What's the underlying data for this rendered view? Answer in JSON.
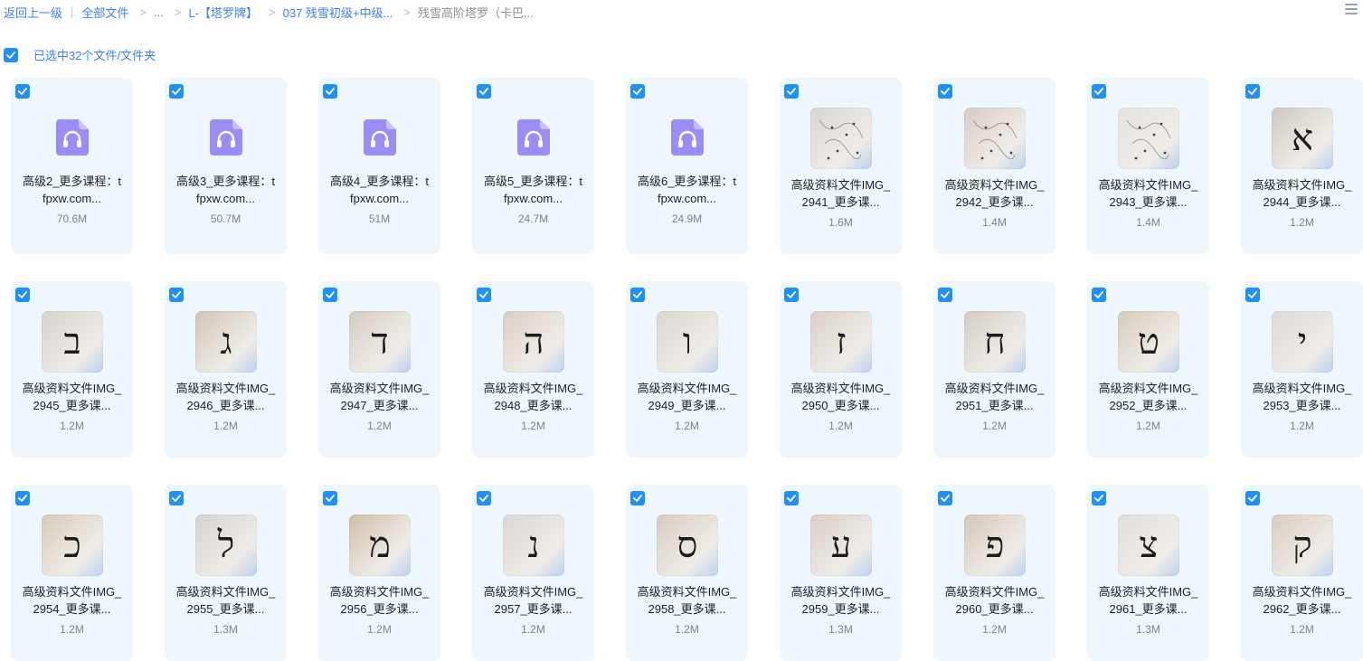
{
  "breadcrumb": {
    "back": "返回上一级",
    "root": "全部文件",
    "ellipsis": "...",
    "crumb1": "L-【塔罗牌】",
    "crumb2": "037 残雪初级+中级...",
    "current": "残雪高阶塔罗（卡巴..."
  },
  "selection": {
    "label": "已选中32个文件/文件夹"
  },
  "files": [
    {
      "type": "audio",
      "name1": "高级2_更多课程：t",
      "name2": "fpxw.com...",
      "size": "70.6M"
    },
    {
      "type": "audio",
      "name1": "高级3_更多课程：t",
      "name2": "fpxw.com...",
      "size": "50.7M"
    },
    {
      "type": "audio",
      "name1": "高级4_更多课程：t",
      "name2": "fpxw.com...",
      "size": "51M"
    },
    {
      "type": "audio",
      "name1": "高级5_更多课程：t",
      "name2": "fpxw.com...",
      "size": "24.7M"
    },
    {
      "type": "audio",
      "name1": "高级6_更多课程：t",
      "name2": "fpxw.com...",
      "size": "24.9M"
    },
    {
      "type": "image",
      "glyph": "",
      "bg": "#d9d6d2",
      "name1": "高级资料文件IMG_",
      "name2": "2941_更多课...",
      "size": "1.6M"
    },
    {
      "type": "image",
      "glyph": "",
      "bg": "#d8ccc6",
      "name1": "高级资料文件IMG_",
      "name2": "2942_更多课...",
      "size": "1.4M"
    },
    {
      "type": "image",
      "glyph": "",
      "bg": "#e6e2df",
      "name1": "高级资料文件IMG_",
      "name2": "2943_更多课...",
      "size": "1.4M"
    },
    {
      "type": "image",
      "glyph": "א",
      "bg": "#cfc9bf",
      "name1": "高级资料文件IMG_",
      "name2": "2944_更多课...",
      "size": "1.2M"
    },
    {
      "type": "image",
      "glyph": "ב",
      "bg": "#d6d3cf",
      "name1": "高级资料文件IMG_",
      "name2": "2945_更多课...",
      "size": "1.2M"
    },
    {
      "type": "image",
      "glyph": "ג",
      "bg": "#cfc6b4",
      "name1": "高级资料文件IMG_",
      "name2": "2946_更多课...",
      "size": "1.2M"
    },
    {
      "type": "image",
      "glyph": "ד",
      "bg": "#d3ccc3",
      "name1": "高级资料文件IMG_",
      "name2": "2947_更多课...",
      "size": "1.2M"
    },
    {
      "type": "image",
      "glyph": "ה",
      "bg": "#d8cfc2",
      "name1": "高级资料文件IMG_",
      "name2": "2948_更多课...",
      "size": "1.2M"
    },
    {
      "type": "image",
      "glyph": "ו",
      "bg": "#dad6d2",
      "name1": "高级资料文件IMG_",
      "name2": "2949_更多课...",
      "size": "1.2M"
    },
    {
      "type": "image",
      "glyph": "ז",
      "bg": "#d6d0c8",
      "name1": "高级资料文件IMG_",
      "name2": "2950_更多课...",
      "size": "1.2M"
    },
    {
      "type": "image",
      "glyph": "ח",
      "bg": "#d2ccc5",
      "name1": "高级资料文件IMG_",
      "name2": "2951_更多课...",
      "size": "1.2M"
    },
    {
      "type": "image",
      "glyph": "ט",
      "bg": "#d7ccba",
      "name1": "高级资料文件IMG_",
      "name2": "2952_更多课...",
      "size": "1.2M"
    },
    {
      "type": "image",
      "glyph": "י",
      "bg": "#dcd9d6",
      "name1": "高级资料文件IMG_",
      "name2": "2953_更多课...",
      "size": "1.2M"
    },
    {
      "type": "image",
      "glyph": "כ",
      "bg": "#d6cbb8",
      "name1": "高级资料文件IMG_",
      "name2": "2954_更多课...",
      "size": "1.2M"
    },
    {
      "type": "image",
      "glyph": "ל",
      "bg": "#d5d2cf",
      "name1": "高级资料文件IMG_",
      "name2": "2955_更多课...",
      "size": "1.3M"
    },
    {
      "type": "image",
      "glyph": "מ",
      "bg": "#cdbfa7",
      "name1": "高级资料文件IMG_",
      "name2": "2956_更多课...",
      "size": "1.2M"
    },
    {
      "type": "image",
      "glyph": "נ",
      "bg": "#dad6d2",
      "name1": "高级资料文件IMG_",
      "name2": "2957_更多课...",
      "size": "1.2M"
    },
    {
      "type": "image",
      "glyph": "ס",
      "bg": "#d5ccbe",
      "name1": "高级资料文件IMG_",
      "name2": "2958_更多课...",
      "size": "1.2M"
    },
    {
      "type": "image",
      "glyph": "ע",
      "bg": "#d8cfc8",
      "name1": "高级资料文件IMG_",
      "name2": "2959_更多课...",
      "size": "1.3M"
    },
    {
      "type": "image",
      "glyph": "פ",
      "bg": "#d3c8b8",
      "name1": "高级资料文件IMG_",
      "name2": "2960_更多课...",
      "size": "1.2M"
    },
    {
      "type": "image",
      "glyph": "צ",
      "bg": "#e1dfdc",
      "name1": "高级资料文件IMG_",
      "name2": "2961_更多课...",
      "size": "1.3M"
    },
    {
      "type": "image",
      "glyph": "ק",
      "bg": "#d6cdbd",
      "name1": "高级资料文件IMG_",
      "name2": "2962_更多课...",
      "size": "1.2M"
    }
  ],
  "colors": {
    "accent": "#1e90ff",
    "link": "#3b82f6",
    "card": "#eef7fd",
    "audio_icon": "#9c8cf5"
  },
  "icons": {
    "audio": "headphones-icon",
    "check": "checkmark-icon",
    "view": "list-view-icon"
  }
}
